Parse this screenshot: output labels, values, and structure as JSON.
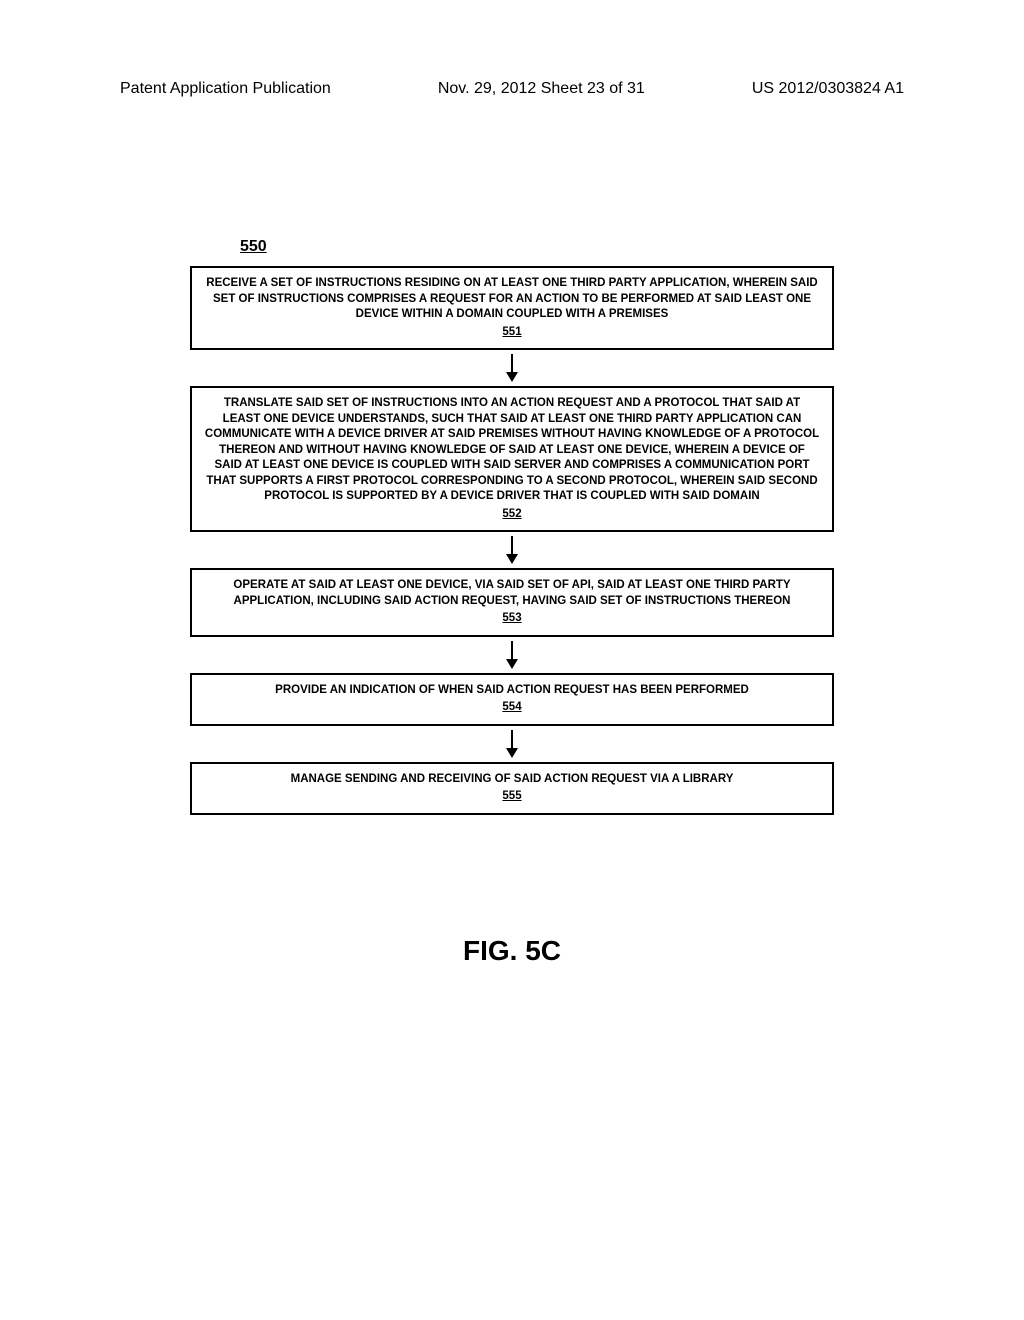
{
  "header": {
    "left": "Patent Application Publication",
    "center": "Nov. 29, 2012  Sheet 23 of 31",
    "right": "US 2012/0303824 A1"
  },
  "diagram_number": "550",
  "boxes": [
    {
      "text": "RECEIVE A SET OF INSTRUCTIONS RESIDING ON AT LEAST ONE THIRD PARTY APPLICATION, WHEREIN SAID SET OF INSTRUCTIONS COMPRISES A REQUEST FOR AN ACTION TO BE PERFORMED AT SAID LEAST ONE DEVICE WITHIN A DOMAIN COUPLED WITH A PREMISES",
      "number": "551"
    },
    {
      "text": "TRANSLATE SAID SET OF INSTRUCTIONS INTO AN ACTION REQUEST AND A PROTOCOL THAT SAID AT LEAST ONE DEVICE UNDERSTANDS, SUCH THAT SAID AT LEAST ONE THIRD PARTY APPLICATION CAN COMMUNICATE WITH A DEVICE DRIVER AT SAID PREMISES WITHOUT HAVING KNOWLEDGE OF A PROTOCOL THEREON AND WITHOUT HAVING KNOWLEDGE OF SAID AT LEAST ONE DEVICE, WHEREIN A DEVICE OF SAID AT LEAST ONE DEVICE IS COUPLED WITH SAID SERVER AND COMPRISES A COMMUNICATION PORT THAT SUPPORTS A FIRST PROTOCOL CORRESPONDING TO A SECOND PROTOCOL, WHEREIN SAID SECOND PROTOCOL IS SUPPORTED BY A DEVICE DRIVER THAT IS COUPLED WITH SAID DOMAIN",
      "number": "552"
    },
    {
      "text": "OPERATE AT SAID AT LEAST ONE DEVICE, VIA SAID SET OF API, SAID AT LEAST ONE THIRD PARTY APPLICATION, INCLUDING SAID ACTION REQUEST, HAVING SAID SET OF INSTRUCTIONS THEREON",
      "number": "553"
    },
    {
      "text": "PROVIDE AN INDICATION OF WHEN SAID ACTION REQUEST HAS BEEN PERFORMED",
      "number": "554"
    },
    {
      "text": "MANAGE SENDING AND RECEIVING OF SAID ACTION REQUEST VIA A LIBRARY",
      "number": "555"
    }
  ],
  "figure_label": "FIG. 5C"
}
